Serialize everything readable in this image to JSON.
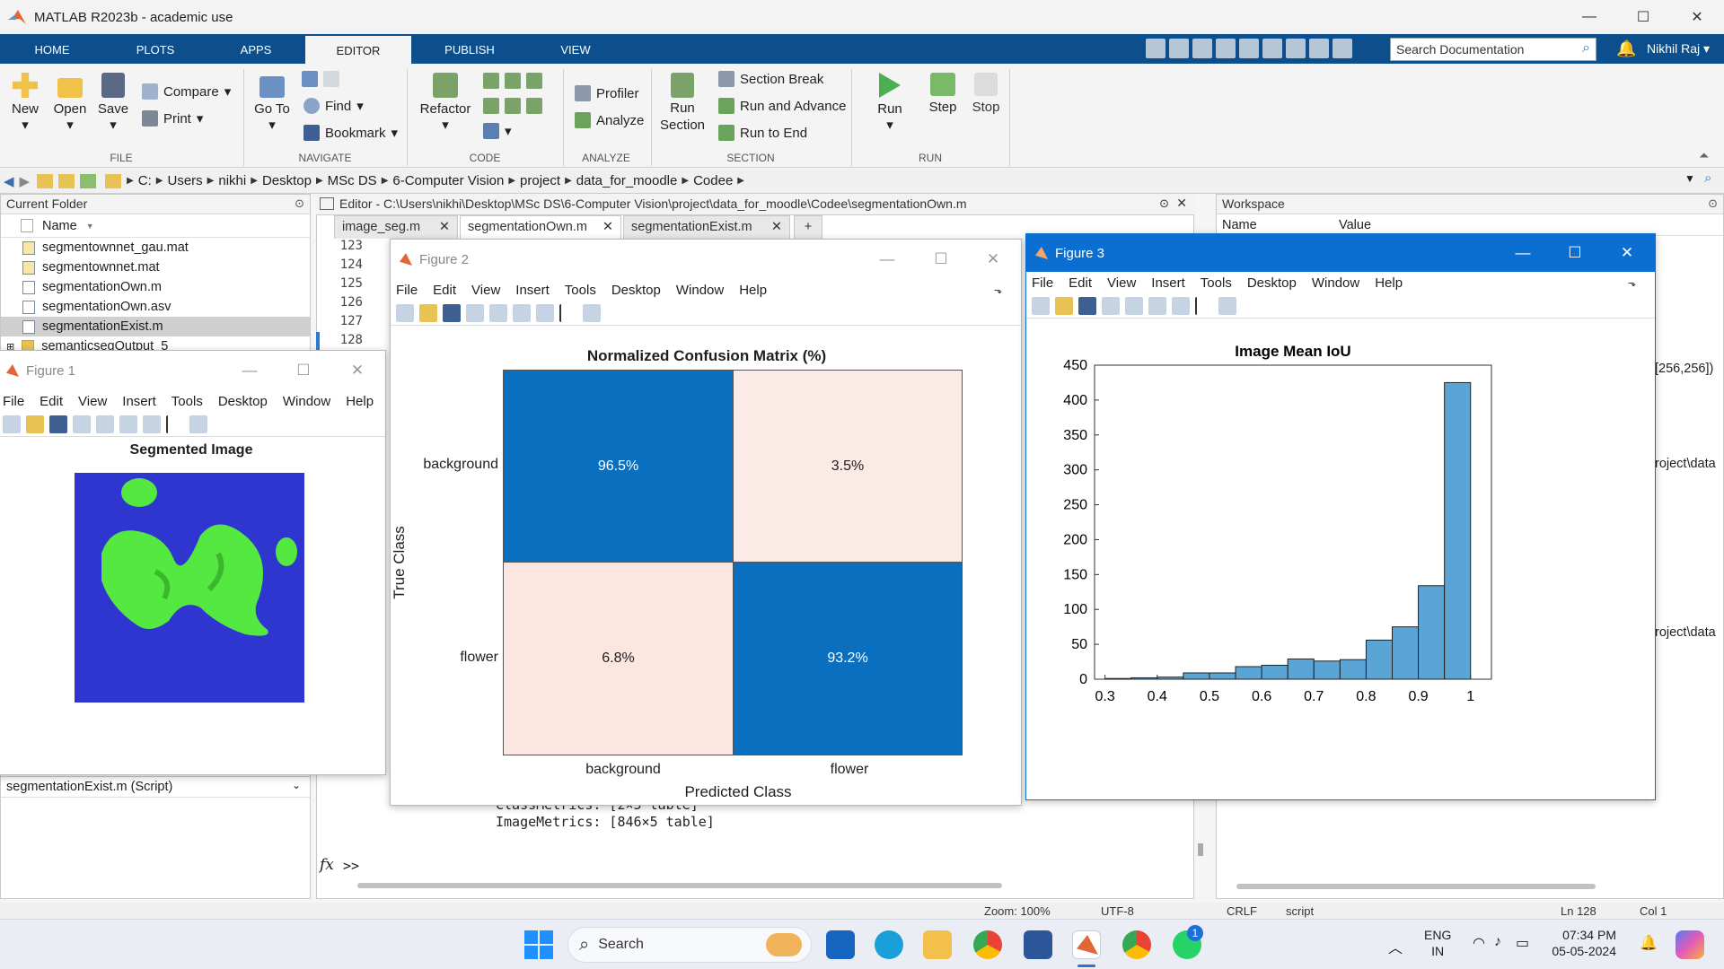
{
  "app": {
    "title": "MATLAB R2023b - academic use"
  },
  "ribbon": {
    "tabs": [
      "HOME",
      "PLOTS",
      "APPS",
      "EDITOR",
      "PUBLISH",
      "VIEW"
    ],
    "active_tab": "EDITOR",
    "search_placeholder": "Search Documentation",
    "user": "Nikhil Raj",
    "file": {
      "new": "New",
      "open": "Open",
      "save": "Save",
      "compare": "Compare",
      "print": "Print",
      "group": "FILE"
    },
    "navigate": {
      "goto": "Go To",
      "find": "Find",
      "bookmark": "Bookmark",
      "group": "NAVIGATE"
    },
    "code": {
      "refactor": "Refactor",
      "group": "CODE"
    },
    "analyze": {
      "profiler": "Profiler",
      "analyze": "Analyze",
      "group": "ANALYZE"
    },
    "section": {
      "run_section": "Run\nSection",
      "section_break": "Section Break",
      "run_advance": "Run and Advance",
      "run_end": "Run to End",
      "group": "SECTION"
    },
    "run": {
      "run": "Run",
      "step": "Step",
      "stop": "Stop",
      "group": "RUN"
    }
  },
  "address": {
    "crumbs": [
      "C:",
      "Users",
      "nikhi",
      "Desktop",
      "MSc DS",
      "6-Computer Vision",
      "project",
      "data_for_moodle",
      "Codee"
    ]
  },
  "current_folder": {
    "title": "Current Folder",
    "col_name": "Name",
    "files": [
      "segmentownnet_gau.mat",
      "segmentownnet.mat",
      "segmentationOwn.m",
      "segmentationOwn.asv",
      "segmentationExist.m",
      "semanticsegOutput_5"
    ],
    "selected": "segmentationExist.m",
    "details": "segmentationExist.m  (Script)"
  },
  "editor": {
    "header": "Editor - C:\\Users\\nikhi\\Desktop\\MSc DS\\6-Computer Vision\\project\\data_for_moodle\\Codee\\segmentationOwn.m",
    "tabs": [
      "image_seg.m",
      "segmentationOwn.m",
      "segmentationExist.m"
    ],
    "active_tab": "segmentationOwn.m",
    "line_numbers": [
      "123",
      "124",
      "125",
      "126",
      "127",
      "128"
    ]
  },
  "command_window": {
    "lines": [
      "ClassMetrics: [2×5 table]",
      "ImageMetrics: [846×5 table]"
    ],
    "prompt": ">>",
    "fx": "fx"
  },
  "workspace": {
    "title": "Workspace",
    "col_name": "Name",
    "col_value": "Value",
    "values": [
      "[256,256])",
      "roject\\data",
      "roject\\data"
    ]
  },
  "figure_menu": [
    "File",
    "Edit",
    "View",
    "Insert",
    "Tools",
    "Desktop",
    "Window",
    "Help"
  ],
  "figure1": {
    "title": "Figure 1",
    "plot_title": "Segmented Image"
  },
  "figure2": {
    "title": "Figure 2",
    "chart_title": "Normalized Confusion Matrix (%)",
    "xlabel": "Predicted Class",
    "ylabel": "True Class",
    "row_labels": [
      "background",
      "flower"
    ],
    "col_labels": [
      "background",
      "flower"
    ],
    "cells": [
      [
        "96.5%",
        "3.5%"
      ],
      [
        "6.8%",
        "93.2%"
      ]
    ]
  },
  "figure3": {
    "title": "Figure 3"
  },
  "chart_data": {
    "type": "bar",
    "title": "Image Mean IoU",
    "xlabel": "",
    "ylabel": "",
    "bin_edges": [
      0.3,
      0.35,
      0.4,
      0.45,
      0.5,
      0.55,
      0.6,
      0.65,
      0.7,
      0.75,
      0.8,
      0.85,
      0.9,
      0.95,
      1.0
    ],
    "values": [
      1,
      2,
      3,
      9,
      9,
      18,
      20,
      29,
      26,
      28,
      56,
      75,
      134,
      425
    ],
    "xlim": [
      0.28,
      1.04
    ],
    "ylim": [
      0,
      450
    ],
    "xticks": [
      "0.3",
      "0.4",
      "0.5",
      "0.6",
      "0.7",
      "0.8",
      "0.9",
      "1"
    ],
    "yticks": [
      "0",
      "50",
      "100",
      "150",
      "200",
      "250",
      "300",
      "350",
      "400",
      "450"
    ],
    "bar_color": "#5aa5d6"
  },
  "statusbar": {
    "zoom": "Zoom: 100%",
    "encoding": "UTF-8",
    "eol": "CRLF",
    "type": "script",
    "ln": "Ln  128",
    "col": "Col  1"
  },
  "taskbar": {
    "search": "Search",
    "lang": "ENG",
    "region": "IN",
    "time": "07:34 PM",
    "date": "05-05-2024",
    "badge": "1"
  }
}
